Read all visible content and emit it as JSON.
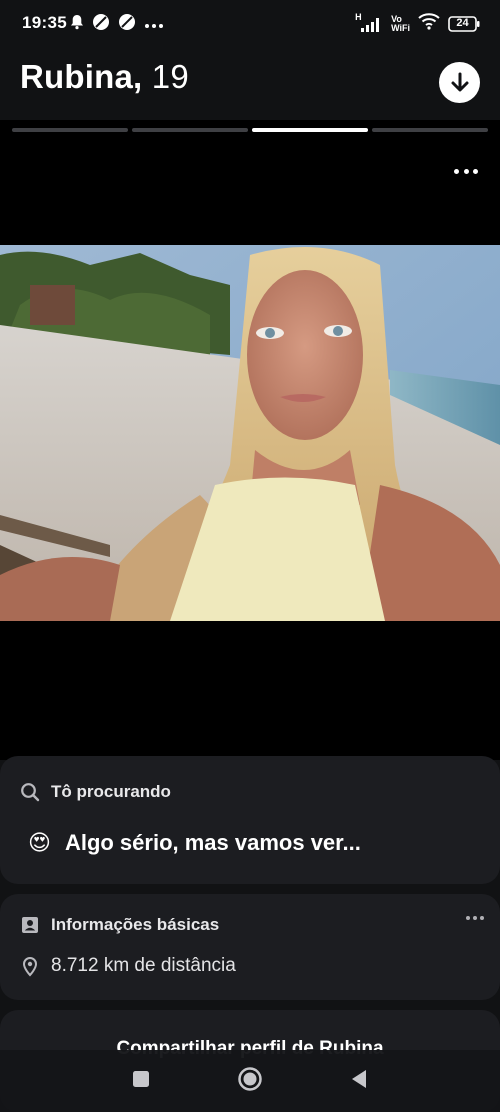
{
  "status_bar": {
    "time": "19:35",
    "network_label_top": "H",
    "volte_top": "Vo",
    "volte_bottom": "WiFi",
    "battery": "24"
  },
  "profile": {
    "name": "Rubina,",
    "age": "19"
  },
  "photos": {
    "count": 4,
    "active_index": 2
  },
  "looking_for": {
    "title": "Tô procurando",
    "emoji": "😍",
    "value": "Algo sério, mas vamos ver..."
  },
  "basic_info": {
    "title": "Informações básicas",
    "distance": "8.712 km de distância"
  },
  "share": {
    "label": "Compartilhar perfil de Rubina"
  },
  "colors": {
    "background": "#111214",
    "card": "#1c1d21",
    "progress_active": "#ffffff",
    "progress_inactive": "#3f4044"
  }
}
